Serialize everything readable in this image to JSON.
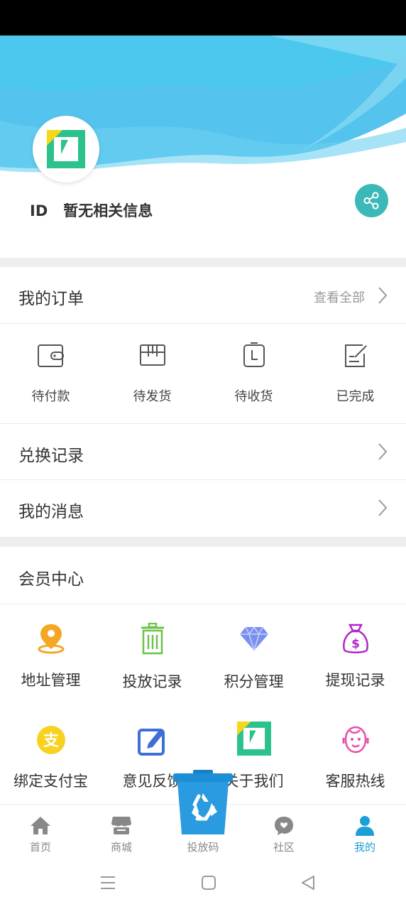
{
  "profile": {
    "id_label": "ID",
    "info": "暂无相关信息"
  },
  "orders": {
    "title": "我的订单",
    "view_all": "查看全部",
    "items": [
      {
        "label": "待付款",
        "icon": "wallet-icon"
      },
      {
        "label": "待发货",
        "icon": "package-icon"
      },
      {
        "label": "待收货",
        "icon": "receive-icon"
      },
      {
        "label": "已完成",
        "icon": "completed-icon"
      }
    ]
  },
  "menu": {
    "exchange_records": "兑换记录",
    "my_messages": "我的消息"
  },
  "member": {
    "title": "会员中心",
    "items": [
      {
        "label": "地址管理",
        "icon": "location-pin-icon"
      },
      {
        "label": "投放记录",
        "icon": "trash-bin-icon"
      },
      {
        "label": "积分管理",
        "icon": "diamond-icon"
      },
      {
        "label": "提现记录",
        "icon": "money-bag-icon"
      },
      {
        "label": "绑定支付宝",
        "icon": "alipay-icon"
      },
      {
        "label": "意见反馈",
        "icon": "edit-icon"
      },
      {
        "label": "关于我们",
        "icon": "logo-icon"
      },
      {
        "label": "客服热线",
        "icon": "customer-service-icon"
      }
    ]
  },
  "tabbar": {
    "items": [
      {
        "label": "首页",
        "icon": "home-icon"
      },
      {
        "label": "商城",
        "icon": "store-icon"
      },
      {
        "label": "投放码",
        "icon": "recycle-bin-icon"
      },
      {
        "label": "社区",
        "icon": "chat-icon"
      },
      {
        "label": "我的",
        "icon": "user-icon"
      }
    ],
    "active": "我的"
  },
  "colors": {
    "accent": "#1b9fd6",
    "share": "#3bb8b8",
    "logo_green": "#2bc28c",
    "logo_yellow": "#f5d81a"
  }
}
